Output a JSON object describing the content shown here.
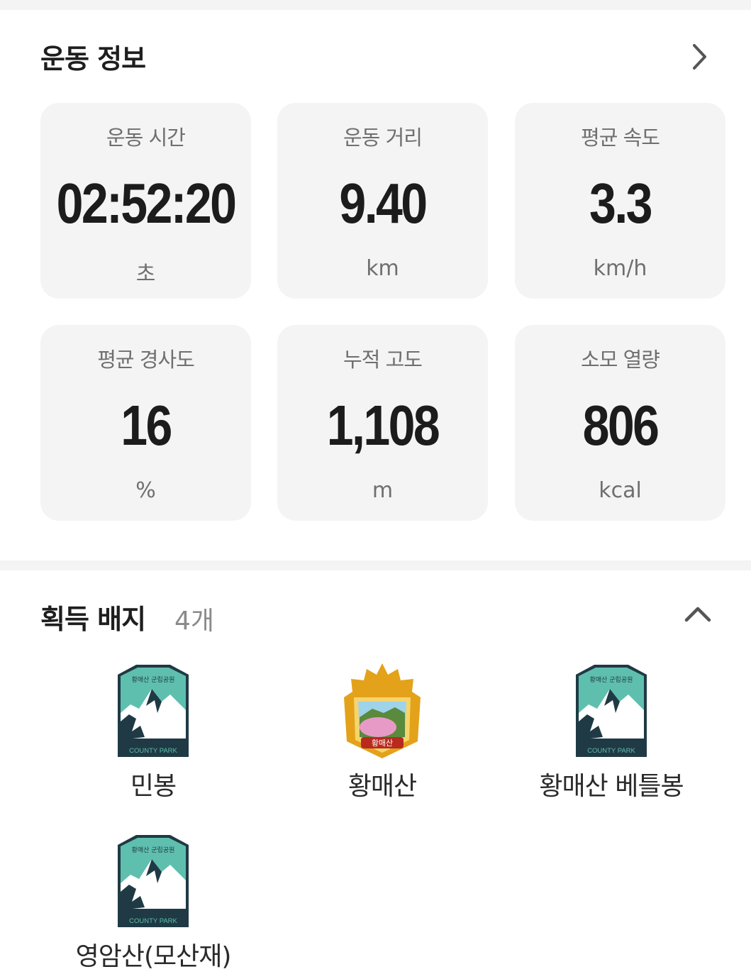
{
  "workout": {
    "title": "운동 정보",
    "stats": [
      {
        "label": "운동 시간",
        "value": "02:52:20",
        "unit": "초"
      },
      {
        "label": "운동 거리",
        "value": "9.40",
        "unit": "km"
      },
      {
        "label": "평균 속도",
        "value": "3.3",
        "unit": "km/h"
      },
      {
        "label": "평균 경사도",
        "value": "16",
        "unit": "%"
      },
      {
        "label": "누적 고도",
        "value": "1,108",
        "unit": "m"
      },
      {
        "label": "소모 열량",
        "value": "806",
        "unit": "kcal"
      }
    ]
  },
  "badges": {
    "title": "획득 배지",
    "count": "4개",
    "items": [
      {
        "name": "민봉",
        "type": "county-park",
        "arc_text": "황매산 군립공원",
        "footer": "COUNTY PARK"
      },
      {
        "name": "황매산",
        "type": "mountain-gold",
        "label": "황매산"
      },
      {
        "name": "황매산 베틀봉",
        "type": "county-park",
        "arc_text": "황매산 군립공원",
        "footer": "COUNTY PARK"
      },
      {
        "name": "영암산(모산재)",
        "type": "county-park",
        "arc_text": "황매산 군립공원",
        "footer": "COUNTY PARK"
      }
    ]
  },
  "icons": {
    "expand": "chevron-right-icon",
    "collapse": "chevron-up-icon"
  },
  "colors": {
    "card_bg": "#f4f4f4",
    "badge_teal": "#5fbfae",
    "badge_navy": "#1f3a44",
    "badge_gold": "#e3a21a"
  }
}
